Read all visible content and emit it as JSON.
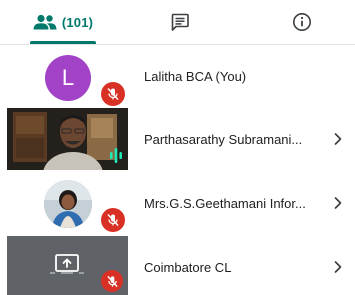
{
  "tabs": {
    "people_count": "(101)",
    "active_color": "#00796b",
    "icons": [
      "people-icon",
      "chat-icon",
      "info-icon"
    ]
  },
  "participants": [
    {
      "name": "Lalitha BCA (You)",
      "initial": "L",
      "avatar_color": "#a142c7",
      "muted": true,
      "has_chevron": false
    },
    {
      "name": "Parthasarathy Subramani...",
      "tile": "video",
      "speaking": true,
      "has_chevron": true
    },
    {
      "name": "Mrs.G.S.Geethamani Infor...",
      "tile": "photo",
      "muted": true,
      "has_chevron": true
    },
    {
      "name": "Coimbatore CL",
      "tile": "screen-share",
      "muted": true,
      "has_chevron": true
    }
  ],
  "colors": {
    "mute_badge": "#d93025",
    "speaking_indicator": "#1de9b6"
  }
}
